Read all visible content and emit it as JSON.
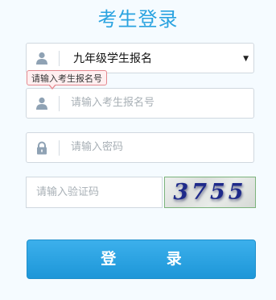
{
  "page_title": "考生登录",
  "exam_type_select": {
    "selected": "九年级学生报名"
  },
  "tooltip": {
    "text": "请输入考生报名号"
  },
  "registration_input": {
    "placeholder": "请输入考生报名号"
  },
  "password_input": {
    "placeholder": "请输入密码"
  },
  "captcha_input": {
    "placeholder": "请输入验证码"
  },
  "captcha_image": {
    "text": "3755"
  },
  "login_button": {
    "label": "登 录"
  },
  "colors": {
    "accent": "#2aa3e0",
    "button": "#1d96d8",
    "icon": "#8fa2b4"
  },
  "icons": {
    "user": "user-icon",
    "lock": "lock-icon",
    "caret": "caret-down-icon"
  }
}
